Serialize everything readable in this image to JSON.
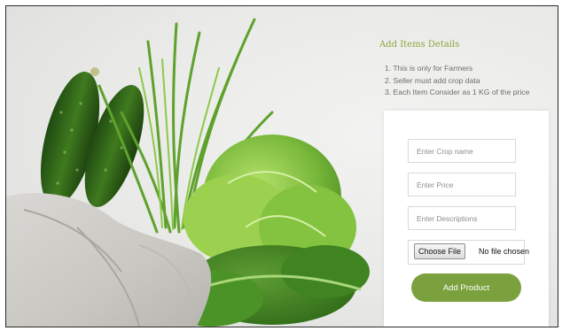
{
  "info": {
    "title": "Add Items Details",
    "items": [
      "1. This is only for Farmers",
      "2. Seller must add crop data",
      "3. Each Item Consider as 1 KG of the price"
    ]
  },
  "form": {
    "crop_name_placeholder": "Enter Crop name",
    "price_placeholder": "Enter Price",
    "descriptions_placeholder": "Enter Descriptions",
    "choose_file_label": "Choose File",
    "no_file_text": "No file chosen",
    "submit_label": "Add Product"
  },
  "colors": {
    "accent": "#7ba13f",
    "title": "#8aa63d"
  }
}
